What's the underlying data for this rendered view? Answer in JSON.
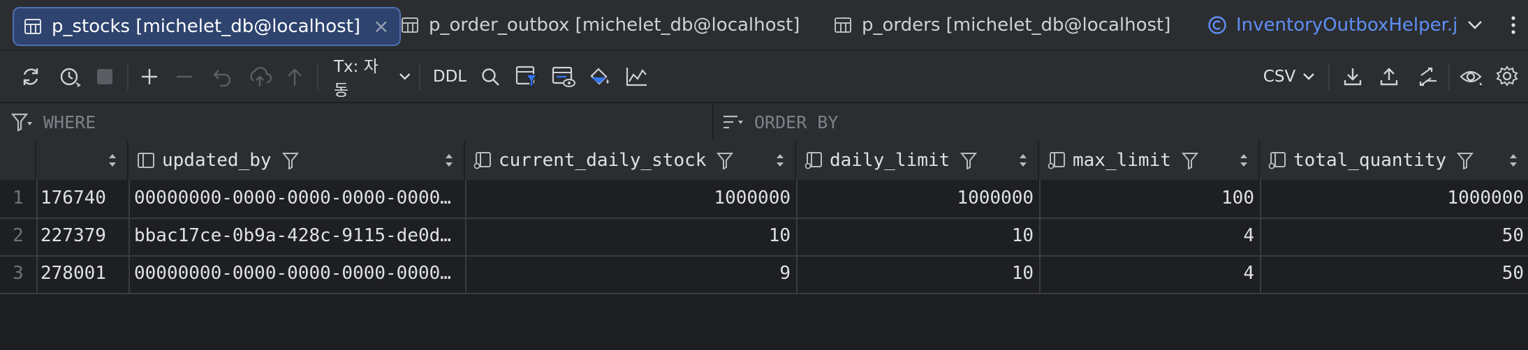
{
  "tabs": [
    {
      "label": "p_stocks [michelet_db@localhost]",
      "active": true,
      "closable": true,
      "icon": "table-icon"
    },
    {
      "label": "p_order_outbox [michelet_db@localhost]",
      "active": false,
      "icon": "table-icon"
    },
    {
      "label": "p_orders [michelet_db@localhost]",
      "active": false,
      "icon": "table-icon"
    },
    {
      "label": "InventoryOutboxHelper.j",
      "active": false,
      "icon": "java-class-icon"
    }
  ],
  "toolbar": {
    "tx_label": "Tx: 자동",
    "ddl_label": "DDL",
    "export_format": "CSV"
  },
  "filter": {
    "where_placeholder": "WHERE",
    "orderby_placeholder": "ORDER BY"
  },
  "grid": {
    "columns": [
      "",
      "updated_by",
      "current_daily_stock",
      "daily_limit",
      "max_limit",
      "total_quantity"
    ],
    "rows": [
      {
        "num": "1",
        "c0": "176740",
        "updated_by": "00000000-0000-0000-0000-0000…",
        "current_daily_stock": "1000000",
        "daily_limit": "1000000",
        "max_limit": "100",
        "total_quantity": "1000000"
      },
      {
        "num": "2",
        "c0": "227379",
        "updated_by": "bbac17ce-0b9a-428c-9115-de0d…",
        "current_daily_stock": "10",
        "daily_limit": "10",
        "max_limit": "4",
        "total_quantity": "50"
      },
      {
        "num": "3",
        "c0": "278001",
        "updated_by": "00000000-0000-0000-0000-0000…",
        "current_daily_stock": "9",
        "daily_limit": "10",
        "max_limit": "4",
        "total_quantity": "50"
      }
    ]
  },
  "colors": {
    "bg": "#1e1f22",
    "panel": "#2b2d30",
    "active_tab": "#2e436e",
    "accent": "#5f8ff5",
    "border": "#393b40"
  }
}
